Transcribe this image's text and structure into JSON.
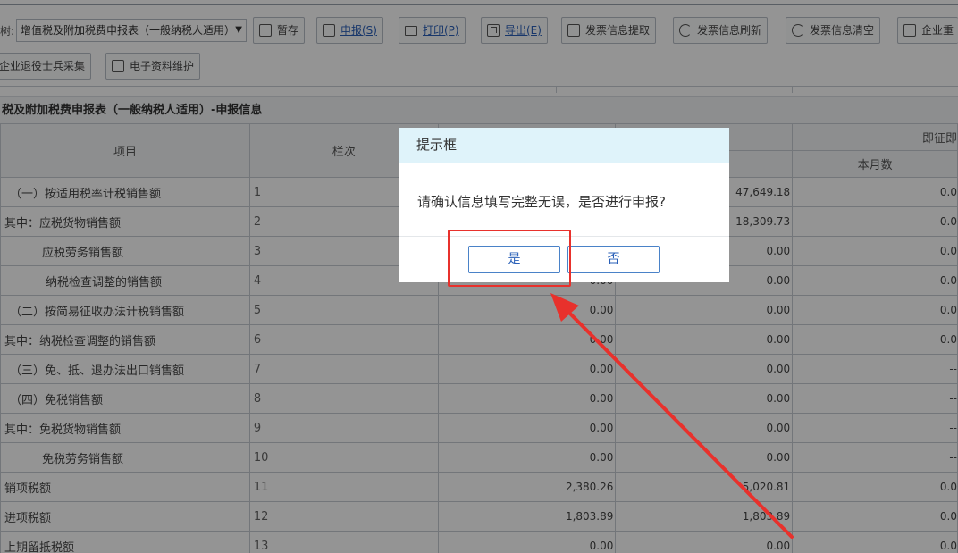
{
  "toolbar": {
    "tree_label": "树:",
    "report_select": "增值税及附加税费申报表（一般纳税人适用）",
    "buttons": {
      "save_temp": "暂存",
      "declare": "申报(S)",
      "print": "打印(P)",
      "export": "导出(E)",
      "invoice_fetch": "发票信息提取",
      "invoice_refresh": "发票信息刷新",
      "invoice_clear": "发票信息清空",
      "enterprise": "企业重",
      "veteran": "企业退役士兵采集",
      "e_docs": "电子资料维护"
    }
  },
  "table": {
    "title": "税及附加税费申报表（一般纳税人适用）-申报信息",
    "headers": {
      "item": "项目",
      "column_no": "栏次",
      "immediate": "即征即",
      "this_month": "本月数"
    },
    "rows": [
      {
        "item": "（一）按适用税率计税销售额",
        "no": "1",
        "v1": "",
        "v2": "47,649.18",
        "v3": "0.0"
      },
      {
        "item": "其中：应税货物销售额",
        "no": "2",
        "v1": "",
        "v2": "18,309.73",
        "v3": "0.0"
      },
      {
        "item": "应税劳务销售额",
        "no": "3",
        "v1": "",
        "v2": "0.00",
        "v3": "0.0"
      },
      {
        "item": "纳税检查调整的销售额",
        "no": "4",
        "v1": "0.00",
        "v2": "0.00",
        "v3": "0.0"
      },
      {
        "item": "（二）按简易征收办法计税销售额",
        "no": "5",
        "v1": "0.00",
        "v2": "0.00",
        "v3": "0.0"
      },
      {
        "item": "其中：纳税检查调整的销售额",
        "no": "6",
        "v1": "0.00",
        "v2": "0.00",
        "v3": "0.0"
      },
      {
        "item": "（三）免、抵、退办法出口销售额",
        "no": "7",
        "v1": "0.00",
        "v2": "0.00",
        "v3": "--"
      },
      {
        "item": "（四）免税销售额",
        "no": "8",
        "v1": "0.00",
        "v2": "0.00",
        "v3": "--"
      },
      {
        "item": "其中：免税货物销售额",
        "no": "9",
        "v1": "0.00",
        "v2": "0.00",
        "v3": "--"
      },
      {
        "item": "免税劳务销售额",
        "no": "10",
        "v1": "0.00",
        "v2": "0.00",
        "v3": "--"
      },
      {
        "item": "销项税额",
        "no": "11",
        "v1": "2,380.26",
        "v2": "5,020.81",
        "v3": "0.0"
      },
      {
        "item": "进项税额",
        "no": "12",
        "v1": "1,803.89",
        "v2": "1,803.89",
        "v3": "0.0"
      },
      {
        "item": "上期留抵税额",
        "no": "13",
        "v1": "0.00",
        "v2": "0.00",
        "v3": "0.0"
      }
    ]
  },
  "dialog": {
    "title": "提示框",
    "message": "请确认信息填写完整无误，是否进行申报?",
    "yes_label": "是",
    "no_label": "否"
  },
  "colors": {
    "highlight": "#e8312c",
    "dialog_header": "#dff3fa",
    "button_border": "#4a82c8"
  }
}
